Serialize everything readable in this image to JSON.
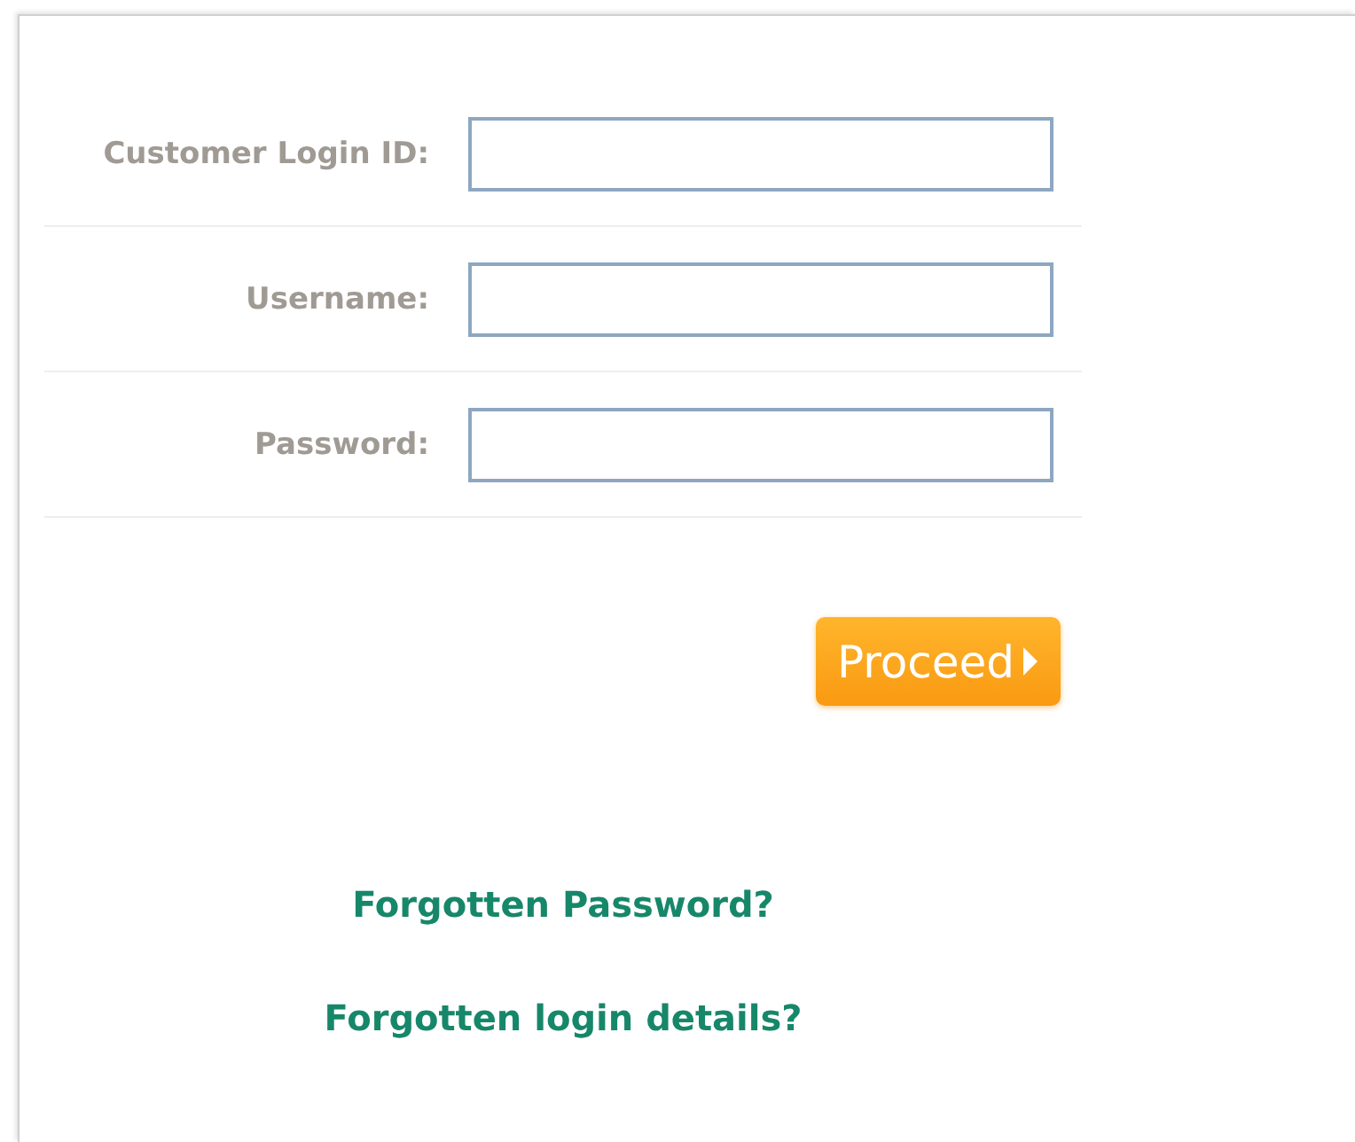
{
  "login_form": {
    "fields": [
      {
        "label": "Customer Login ID:"
      },
      {
        "label": "Username:"
      },
      {
        "label": "Password:"
      }
    ],
    "submit_button": {
      "label": "Proceed"
    },
    "links": [
      "Forgotten Password?",
      "Forgotten login details?"
    ]
  }
}
